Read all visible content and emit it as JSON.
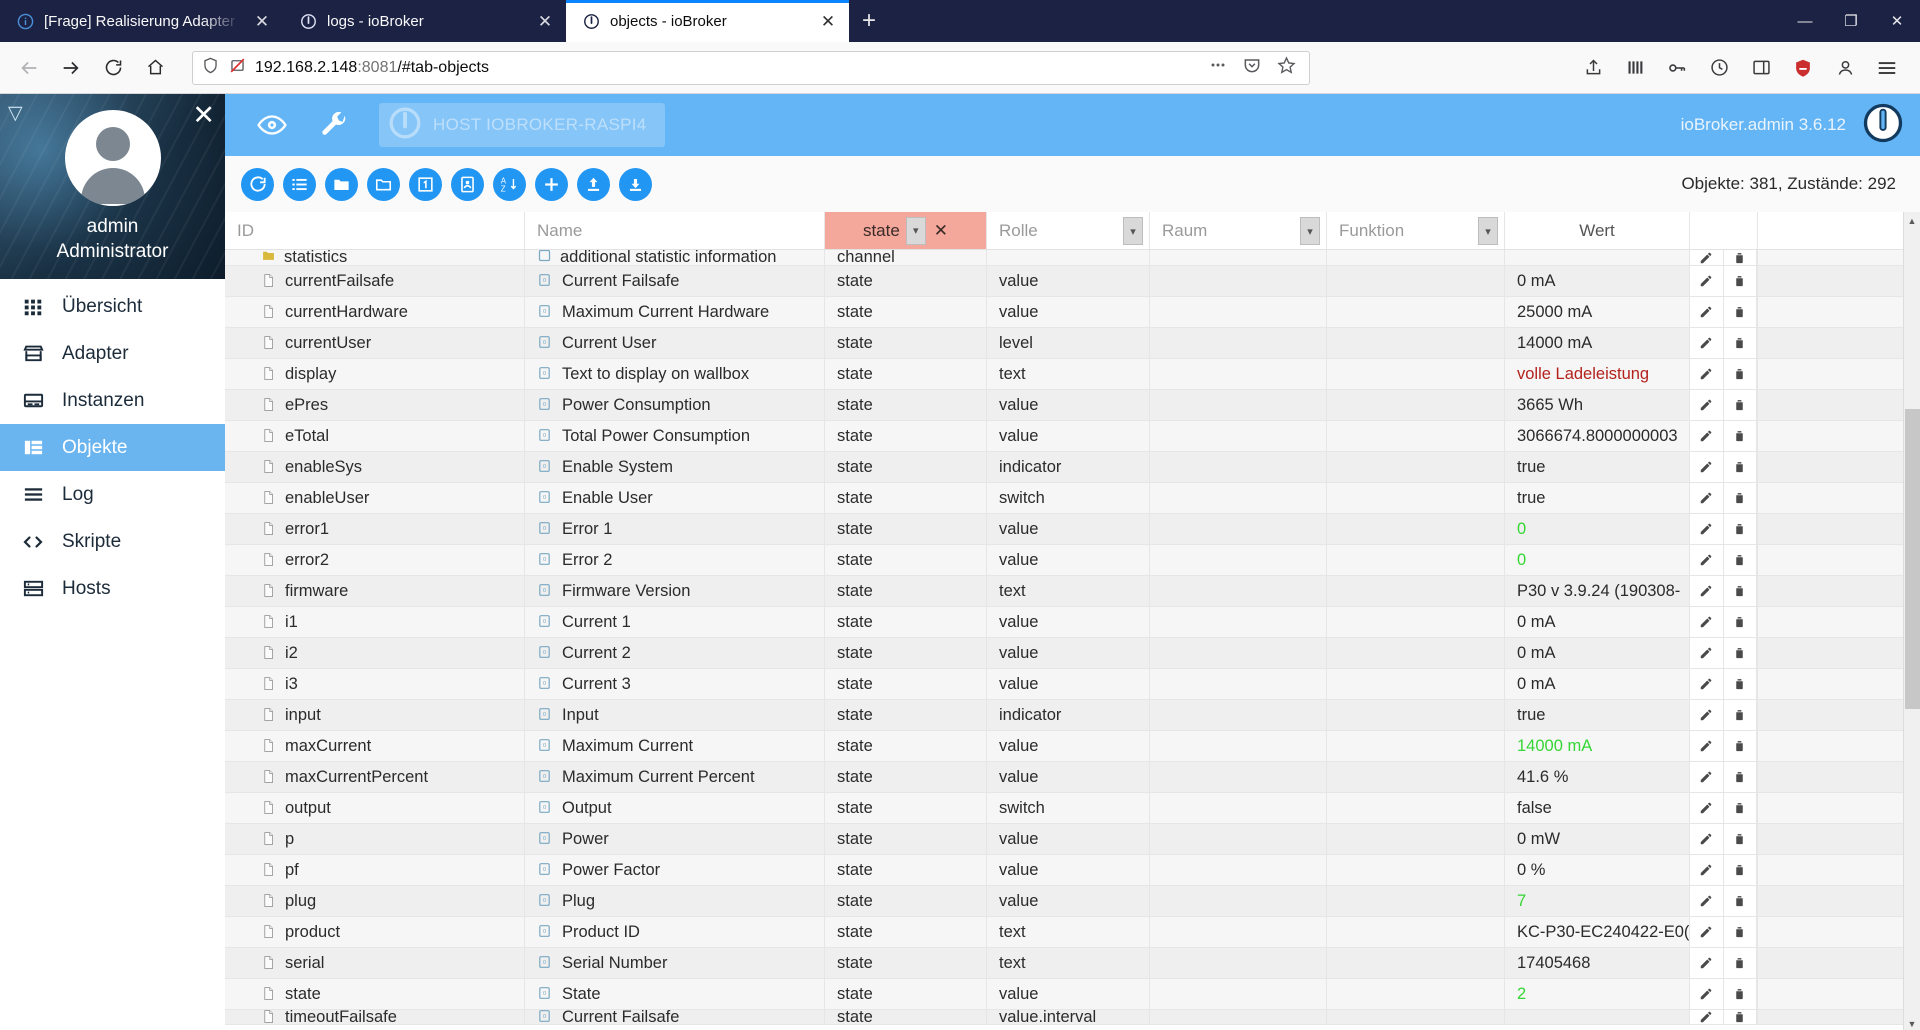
{
  "browser": {
    "tabs": [
      {
        "title": "[Frage] Realisierung Adapter U",
        "favicon": "info-icon",
        "active": false
      },
      {
        "title": "logs - ioBroker",
        "favicon": "iobroker-icon",
        "active": false
      },
      {
        "title": "objects - ioBroker",
        "favicon": "iobroker-icon",
        "active": true
      }
    ],
    "new_tab_label": "+",
    "window_controls": {
      "minimize": "—",
      "maximize": "❐",
      "close": "✕"
    },
    "nav": {
      "back": "←",
      "forward": "→",
      "reload": "⟳",
      "home": "⌂"
    },
    "url": {
      "host": "192.168.2.148",
      "port": ":8081",
      "path": "/#tab-objects"
    },
    "url_icons": [
      "shield-icon",
      "no-tracking-icon",
      "ellipsis-icon",
      "pocket-icon",
      "star-icon"
    ],
    "toolbar_right_icons": [
      "share-icon",
      "library-icon",
      "password-icon",
      "history-icon",
      "sidebar-icon",
      "ublock-icon",
      "account-icon",
      "menu-icon"
    ]
  },
  "sidebar": {
    "expand_icon": "collapse-icon",
    "close_icon": "close-icon",
    "user": "admin",
    "role": "Administrator",
    "items": [
      {
        "label": "Übersicht",
        "icon": "grid-icon",
        "active": false
      },
      {
        "label": "Adapter",
        "icon": "store-icon",
        "active": false
      },
      {
        "label": "Instanzen",
        "icon": "instances-icon",
        "active": false
      },
      {
        "label": "Objekte",
        "icon": "objects-icon",
        "active": true
      },
      {
        "label": "Log",
        "icon": "log-icon",
        "active": false
      },
      {
        "label": "Skripte",
        "icon": "code-icon",
        "active": false
      },
      {
        "label": "Hosts",
        "icon": "hosts-icon",
        "active": false
      }
    ]
  },
  "app_header": {
    "eye_icon": "eye-icon",
    "wrench_icon": "wrench-icon",
    "host_chip": {
      "icon": "iobroker-logo-icon",
      "label": "HOST IOBROKER-RASPI4"
    },
    "version": "ioBroker.admin 3.6.12",
    "logo_icon": "iobroker-logo-icon"
  },
  "toolbar": {
    "buttons": [
      {
        "icon": "refresh-icon",
        "name": "refresh-button"
      },
      {
        "icon": "list-icon",
        "name": "expand-list-button"
      },
      {
        "icon": "folder-filled-icon",
        "name": "expand-all-button"
      },
      {
        "icon": "folder-outline-icon",
        "name": "collapse-all-button"
      },
      {
        "icon": "number-one-icon",
        "name": "expand-one-level-button"
      },
      {
        "icon": "contact-icon",
        "name": "show-names-button"
      },
      {
        "icon": "sort-az-icon",
        "name": "sort-button"
      },
      {
        "icon": "plus-icon",
        "name": "add-object-button"
      },
      {
        "icon": "upload-icon",
        "name": "import-button"
      },
      {
        "icon": "download-icon",
        "name": "export-button"
      }
    ],
    "object_count": "Objekte: 381, Zustände: 292"
  },
  "table": {
    "columns": [
      {
        "key": "id",
        "label": "ID",
        "type": "text",
        "filtered": false
      },
      {
        "key": "name",
        "label": "Name",
        "type": "text",
        "filtered": false
      },
      {
        "key": "type",
        "label": "state",
        "type": "filter",
        "filtered": true,
        "clear": "✕"
      },
      {
        "key": "role",
        "label": "Rolle",
        "type": "select",
        "filtered": false
      },
      {
        "key": "room",
        "label": "Raum",
        "type": "select",
        "filtered": false
      },
      {
        "key": "func",
        "label": "Funktion",
        "type": "select",
        "filtered": false
      },
      {
        "key": "val",
        "label": "Wert",
        "type": "static",
        "filtered": false
      },
      {
        "key": "acts",
        "label": "",
        "type": "static",
        "filtered": false
      }
    ],
    "partial_top_row": {
      "id": "statistics",
      "name": "additional statistic information",
      "type": "channel"
    },
    "partial_bottom_row": {
      "id": "timeoutFailsafe",
      "name": "Current Failsafe",
      "type": "state",
      "role": "value.interval"
    },
    "rows": [
      {
        "id": "currentFailsafe",
        "name": "Current Failsafe",
        "type": "state",
        "role": "value",
        "room": "",
        "func": "",
        "val": "0 mA",
        "val_color": "normal"
      },
      {
        "id": "currentHardware",
        "name": "Maximum Current Hardware",
        "type": "state",
        "role": "value",
        "room": "",
        "func": "",
        "val": "25000 mA",
        "val_color": "normal"
      },
      {
        "id": "currentUser",
        "name": "Current User",
        "type": "state",
        "role": "level",
        "room": "",
        "func": "",
        "val": "14000 mA",
        "val_color": "normal"
      },
      {
        "id": "display",
        "name": "Text to display on wallbox",
        "type": "state",
        "role": "text",
        "room": "",
        "func": "",
        "val": "volle Ladeleistung",
        "val_color": "red"
      },
      {
        "id": "ePres",
        "name": "Power Consumption",
        "type": "state",
        "role": "value",
        "room": "",
        "func": "",
        "val": "3665 Wh",
        "val_color": "normal"
      },
      {
        "id": "eTotal",
        "name": "Total Power Consumption",
        "type": "state",
        "role": "value",
        "room": "",
        "func": "",
        "val": "3066674.8000000003",
        "val_color": "normal"
      },
      {
        "id": "enableSys",
        "name": "Enable System",
        "type": "state",
        "role": "indicator",
        "room": "",
        "func": "",
        "val": "true",
        "val_color": "normal"
      },
      {
        "id": "enableUser",
        "name": "Enable User",
        "type": "state",
        "role": "switch",
        "room": "",
        "func": "",
        "val": "true",
        "val_color": "normal"
      },
      {
        "id": "error1",
        "name": "Error 1",
        "type": "state",
        "role": "value",
        "room": "",
        "func": "",
        "val": "0",
        "val_color": "green"
      },
      {
        "id": "error2",
        "name": "Error 2",
        "type": "state",
        "role": "value",
        "room": "",
        "func": "",
        "val": "0",
        "val_color": "green"
      },
      {
        "id": "firmware",
        "name": "Firmware Version",
        "type": "state",
        "role": "text",
        "room": "",
        "func": "",
        "val": "P30 v 3.9.24 (190308-",
        "val_color": "normal"
      },
      {
        "id": "i1",
        "name": "Current 1",
        "type": "state",
        "role": "value",
        "room": "",
        "func": "",
        "val": "0 mA",
        "val_color": "normal"
      },
      {
        "id": "i2",
        "name": "Current 2",
        "type": "state",
        "role": "value",
        "room": "",
        "func": "",
        "val": "0 mA",
        "val_color": "normal"
      },
      {
        "id": "i3",
        "name": "Current 3",
        "type": "state",
        "role": "value",
        "room": "",
        "func": "",
        "val": "0 mA",
        "val_color": "normal"
      },
      {
        "id": "input",
        "name": "Input",
        "type": "state",
        "role": "indicator",
        "room": "",
        "func": "",
        "val": "true",
        "val_color": "normal"
      },
      {
        "id": "maxCurrent",
        "name": "Maximum Current",
        "type": "state",
        "role": "value",
        "room": "",
        "func": "",
        "val": "14000 mA",
        "val_color": "green"
      },
      {
        "id": "maxCurrentPercent",
        "name": "Maximum Current Percent",
        "type": "state",
        "role": "value",
        "room": "",
        "func": "",
        "val": "41.6 %",
        "val_color": "normal"
      },
      {
        "id": "output",
        "name": "Output",
        "type": "state",
        "role": "switch",
        "room": "",
        "func": "",
        "val": "false",
        "val_color": "normal"
      },
      {
        "id": "p",
        "name": "Power",
        "type": "state",
        "role": "value",
        "room": "",
        "func": "",
        "val": "0 mW",
        "val_color": "normal"
      },
      {
        "id": "pf",
        "name": "Power Factor",
        "type": "state",
        "role": "value",
        "room": "",
        "func": "",
        "val": "0 %",
        "val_color": "normal"
      },
      {
        "id": "plug",
        "name": "Plug",
        "type": "state",
        "role": "value",
        "room": "",
        "func": "",
        "val": "7",
        "val_color": "green"
      },
      {
        "id": "product",
        "name": "Product ID",
        "type": "state",
        "role": "text",
        "room": "",
        "func": "",
        "val": "KC-P30-EC240422-E0(",
        "val_color": "normal"
      },
      {
        "id": "serial",
        "name": "Serial Number",
        "type": "state",
        "role": "text",
        "room": "",
        "func": "",
        "val": "17405468",
        "val_color": "normal"
      },
      {
        "id": "state",
        "name": "State",
        "type": "state",
        "role": "value",
        "room": "",
        "func": "",
        "val": "2",
        "val_color": "green"
      }
    ],
    "row_actions": [
      {
        "icon": "pencil-icon",
        "name": "edit-row-button"
      },
      {
        "icon": "trash-icon",
        "name": "delete-row-button"
      }
    ]
  },
  "colors": {
    "accent": "#64b5f6",
    "accent_dark": "#2196f3",
    "tabstrip": "#1c2243",
    "filter_active": "#f4a79b",
    "value_green": "#35d635",
    "value_red": "#b3221c"
  }
}
